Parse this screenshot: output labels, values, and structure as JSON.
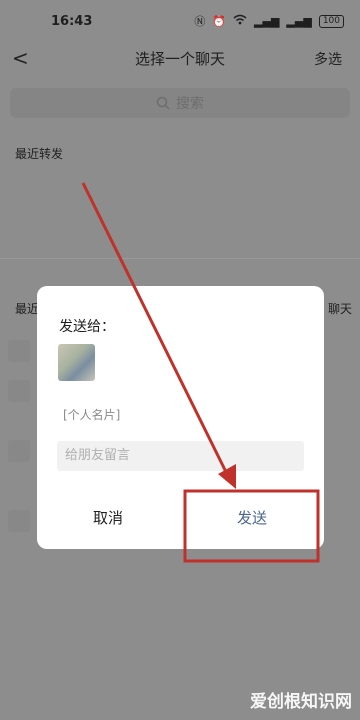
{
  "status_bar": {
    "time": "16:43",
    "battery": "100"
  },
  "header": {
    "title": "选择一个聊天",
    "multi_select": "多选"
  },
  "search": {
    "placeholder": "搜索"
  },
  "sections": {
    "recent_forward": "最近转发",
    "recent_chat_cut": "最近",
    "right_cut": "聊天"
  },
  "dialog": {
    "title": "发送给：",
    "card_label": "[个人名片]",
    "message_placeholder": "给朋友留言",
    "cancel": "取消",
    "send": "发送"
  },
  "watermark": "爱创根知识网"
}
